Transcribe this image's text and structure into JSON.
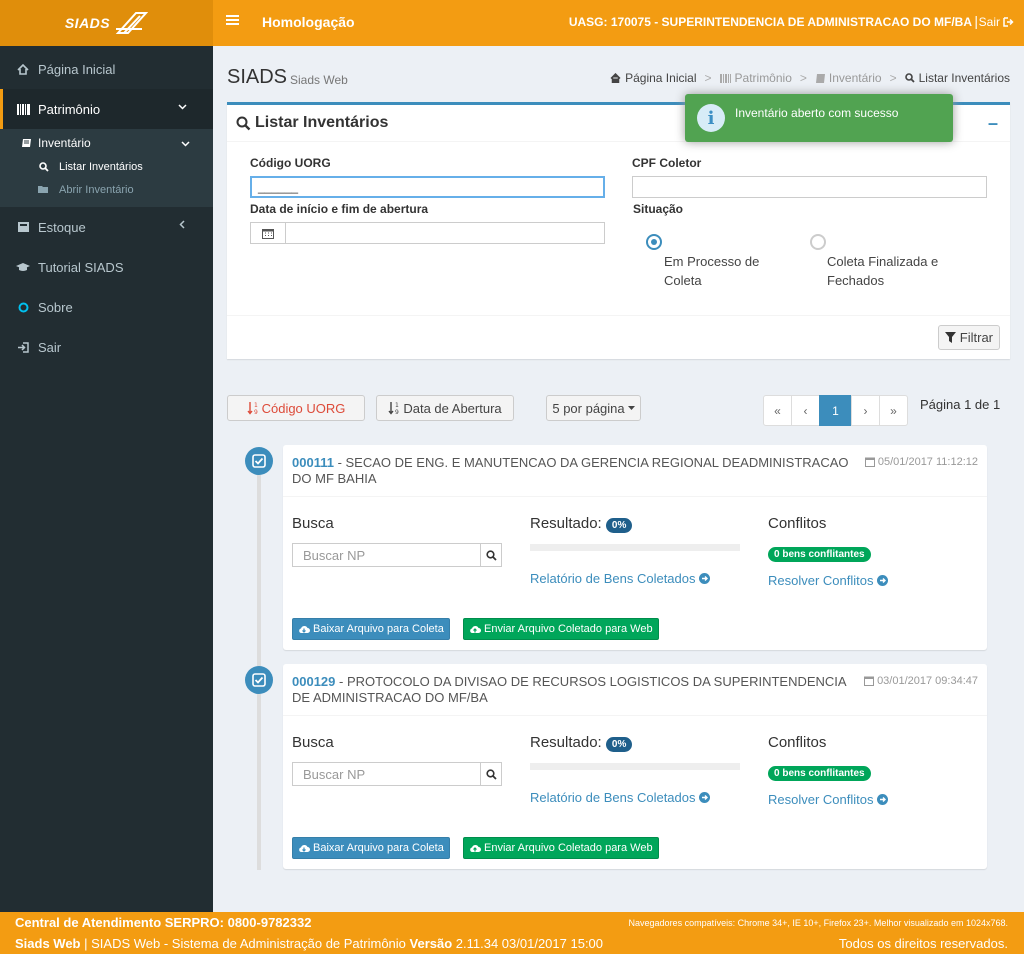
{
  "topbar": {
    "logo": "SIADS",
    "environment": "Homologação",
    "uasg": "UASG: 170075 - SUPERINTENDENCIA DE ADMINISTRACAO DO MF/BA",
    "separator": "|",
    "logout": "Sair"
  },
  "sidebar": {
    "items": [
      {
        "label": "Página Inicial"
      },
      {
        "label": "Patrimônio"
      },
      {
        "label": "Estoque"
      },
      {
        "label": "Tutorial SIADS"
      },
      {
        "label": "Sobre"
      },
      {
        "label": "Sair"
      }
    ],
    "sub": {
      "label": "Inventário",
      "children": [
        {
          "label": "Listar Inventários"
        },
        {
          "label": "Abrir Inventário"
        }
      ]
    }
  },
  "header": {
    "title": "SIADS",
    "subtitle": "Siads Web",
    "breadcrumb": [
      "Página Inicial",
      "Patrimônio",
      "Inventário",
      "Listar Inventários"
    ],
    "breadcrumb_sep": ">"
  },
  "toast": {
    "message": "Inventário aberto com sucesso"
  },
  "filter": {
    "title": "Listar Inventários",
    "codigo_label": "Código UORG",
    "codigo_value": "______",
    "cpf_label": "CPF Coletor",
    "cpf_value": "",
    "data_label": "Data de início e fim de abertura",
    "data_value": "",
    "situacao_label": "Situação",
    "option1": "Em Processo de Coleta",
    "option2": "Coleta Finalizada e Fechados",
    "filter_button": "Filtrar"
  },
  "sortbar": {
    "sort_codigo": "Código UORG",
    "sort_data": "Data de Abertura",
    "per_page": "5 por página",
    "pages": [
      "«",
      "‹",
      "1",
      "›",
      "»"
    ],
    "page_info": "Página 1 de 1"
  },
  "inventories": [
    {
      "code": "000111",
      "title": " - SECAO DE ENG. E MANUTENCAO DA GERENCIA REGIONAL DEADMINISTRACAO DO MF BAHIA",
      "date": "05/01/2017 11:12:12",
      "busca_label": "Busca",
      "busca_placeholder": "Buscar NP",
      "resultado_label": "Resultado:",
      "resultado_value": "0%",
      "resultado_progress": 0,
      "relatorio_link": "Relatório de Bens Coletados",
      "conflitos_label": "Conflitos",
      "conflitos_badge": "0 bens conflitantes",
      "resolver_link": "Resolver Conflitos",
      "download_button": "Baixar Arquivo para Coleta",
      "upload_button": "Enviar Arquivo Coletado para Web"
    },
    {
      "code": "000129",
      "title": " - PROTOCOLO DA DIVISAO DE RECURSOS LOGISTICOS DA SUPERINTENDENCIA DE ADMINISTRACAO DO MF/BA",
      "date": "03/01/2017 09:34:47",
      "busca_label": "Busca",
      "busca_placeholder": "Buscar NP",
      "resultado_label": "Resultado:",
      "resultado_value": "0%",
      "resultado_progress": 0,
      "relatorio_link": "Relatório de Bens Coletados",
      "conflitos_label": "Conflitos",
      "conflitos_badge": "0 bens conflitantes",
      "resolver_link": "Resolver Conflitos",
      "download_button": "Baixar Arquivo para Coleta",
      "upload_button": "Enviar Arquivo Coletado para Web"
    }
  ],
  "footer": {
    "central": "Central de Atendimento SERPRO: 0800-9782332",
    "browsers": "Navegadores compatíveis: Chrome 34+, IE 10+, Firefox 23+. Melhor visualizado em 1024x768.",
    "app_name": "Siads Web",
    "app_desc": " | SIADS Web - Sistema de Administração de Patrimônio  ",
    "version_label": "Versão",
    "version_value": " 2.11.34 03/01/2017 15:00",
    "rights": "Todos os direitos reservados."
  },
  "colors": {
    "orange": "#f39c12",
    "sidebar": "#222d32",
    "primary": "#3c8dbc",
    "success": "#00a65a",
    "toast": "#51a351"
  }
}
